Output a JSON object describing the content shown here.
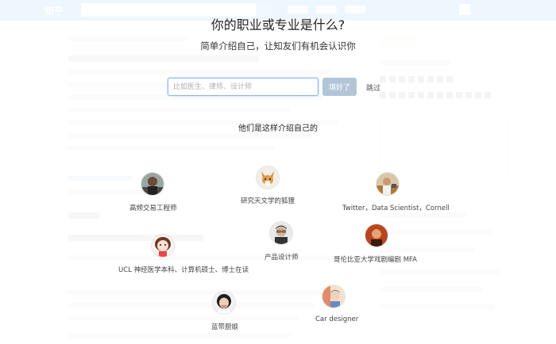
{
  "modal": {
    "title": "你的职业或专业是什么?",
    "subtitle": "简单介绍自己，让知友们有机会认识你",
    "input": {
      "placeholder": "比如医生、律师、设计师",
      "value": ""
    },
    "done_label": "填好了",
    "skip_label": "跳过",
    "examples_heading": "他们是这样介绍自己的"
  },
  "background": {
    "logo": "知乎"
  },
  "people": [
    {
      "label": "高频交易工程师",
      "avatar_icon": "man-dark-avatar-icon"
    },
    {
      "label": "研究天文学的狐狸",
      "avatar_icon": "fox-avatar-icon"
    },
    {
      "label": "Twitter，Data Scientist，Cornell",
      "avatar_icon": "man-desk-avatar-icon"
    },
    {
      "label": "产品设计师",
      "avatar_icon": "man-glasses-avatar-icon"
    },
    {
      "label": "UCL 神经医学本科、计算机硕士、博士在读",
      "avatar_icon": "cartoon-girl-avatar-icon"
    },
    {
      "label": "哥伦比亚大学戏剧编剧 MFA",
      "avatar_icon": "warm-portrait-avatar-icon"
    },
    {
      "label": "蓝带厨娘",
      "avatar_icon": "woman-smile-avatar-icon"
    },
    {
      "label": "Car designer",
      "avatar_icon": "colorful-avatar-icon"
    }
  ],
  "colors": {
    "brand_blue": "#0f88eb",
    "input_border": "#8bb6e6",
    "button_disabled": "#b3c6d8"
  }
}
